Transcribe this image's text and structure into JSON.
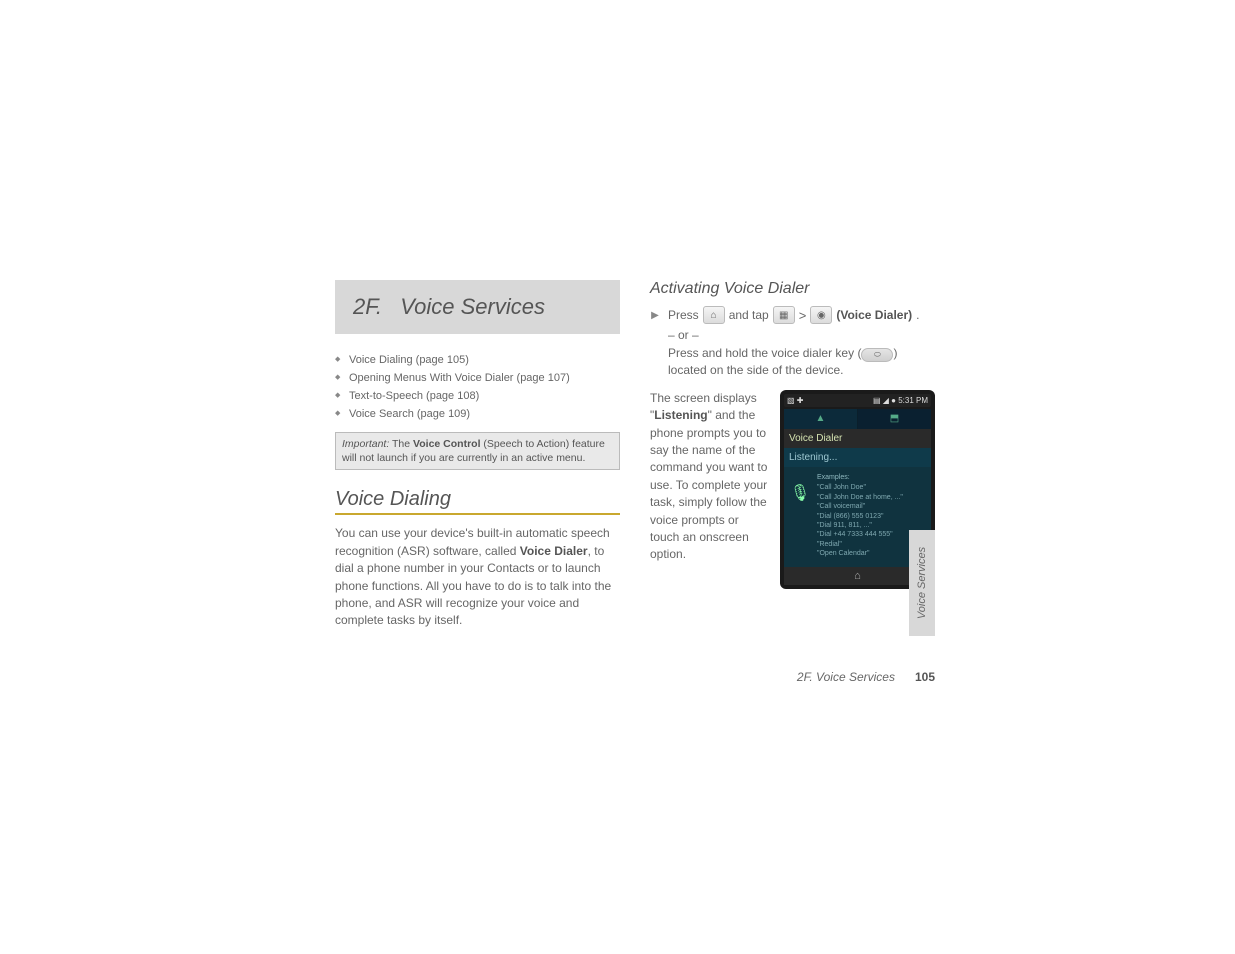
{
  "section": {
    "number": "2F.",
    "title": "Voice Services"
  },
  "toc": [
    "Voice Dialing (page 105)",
    "Opening Menus With Voice Dialer (page 107)",
    "Text-to-Speech (page 108)",
    "Voice Search (page 109)"
  ],
  "important": {
    "label": "Important:",
    "text_pre": "The ",
    "text_bold": "Voice Control",
    "text_post": " (Speech to Action) feature will not launch if you are currently in an active menu."
  },
  "voice_dialing": {
    "heading": "Voice Dialing",
    "para_pre": "You can use your device's built-in automatic speech recognition (ASR) software, called ",
    "para_bold": "Voice Dialer",
    "para_post": ", to dial a phone number in your Contacts or to launch phone functions. All you have to do is to talk into the phone, and ASR will recognize your voice and complete tasks by itself."
  },
  "activating": {
    "heading": "Activating Voice Dialer",
    "press": "Press",
    "and_tap": "and tap",
    "gt": ">",
    "label_bold": "(Voice Dialer)",
    "dot": ".",
    "or": "– or –",
    "alt_pre": "Press and hold the voice dialer key (",
    "alt_post": ") located on the side of the device.",
    "desc_pre": "The screen displays \"",
    "desc_bold": "Listening",
    "desc_post": "\" and the phone prompts you to say the name of the command you want to use. To complete your task, simply follow the voice prompts or touch an onscreen option."
  },
  "phone": {
    "status_left": "▧ ✚",
    "status_right": "▤ ◢ ● 5:31 PM",
    "tab_left": "▲",
    "tab_right": "⬒",
    "app_title": "Voice Dialer",
    "listening": "Listening...",
    "mic_glyph": "🎙",
    "examples_head": "Examples:",
    "examples": [
      "\"Call John Doe\"",
      "\"Call John Doe at home, ...\"",
      "\"Call voicemail\"",
      "\"Dial (866) 555 0123\"",
      "\"Dial 911, 811, ...\"",
      "\"Dial +44 7333 444 555\"",
      "\"Redial\"",
      "\"Open Calendar\""
    ],
    "home_glyph": "⌂"
  },
  "icons": {
    "home": "⌂",
    "grid": "▦",
    "voice": "◉",
    "side_key": "⬭"
  },
  "side_tab": "Voice Services",
  "footer": {
    "section": "2F. Voice Services",
    "page": "105"
  }
}
